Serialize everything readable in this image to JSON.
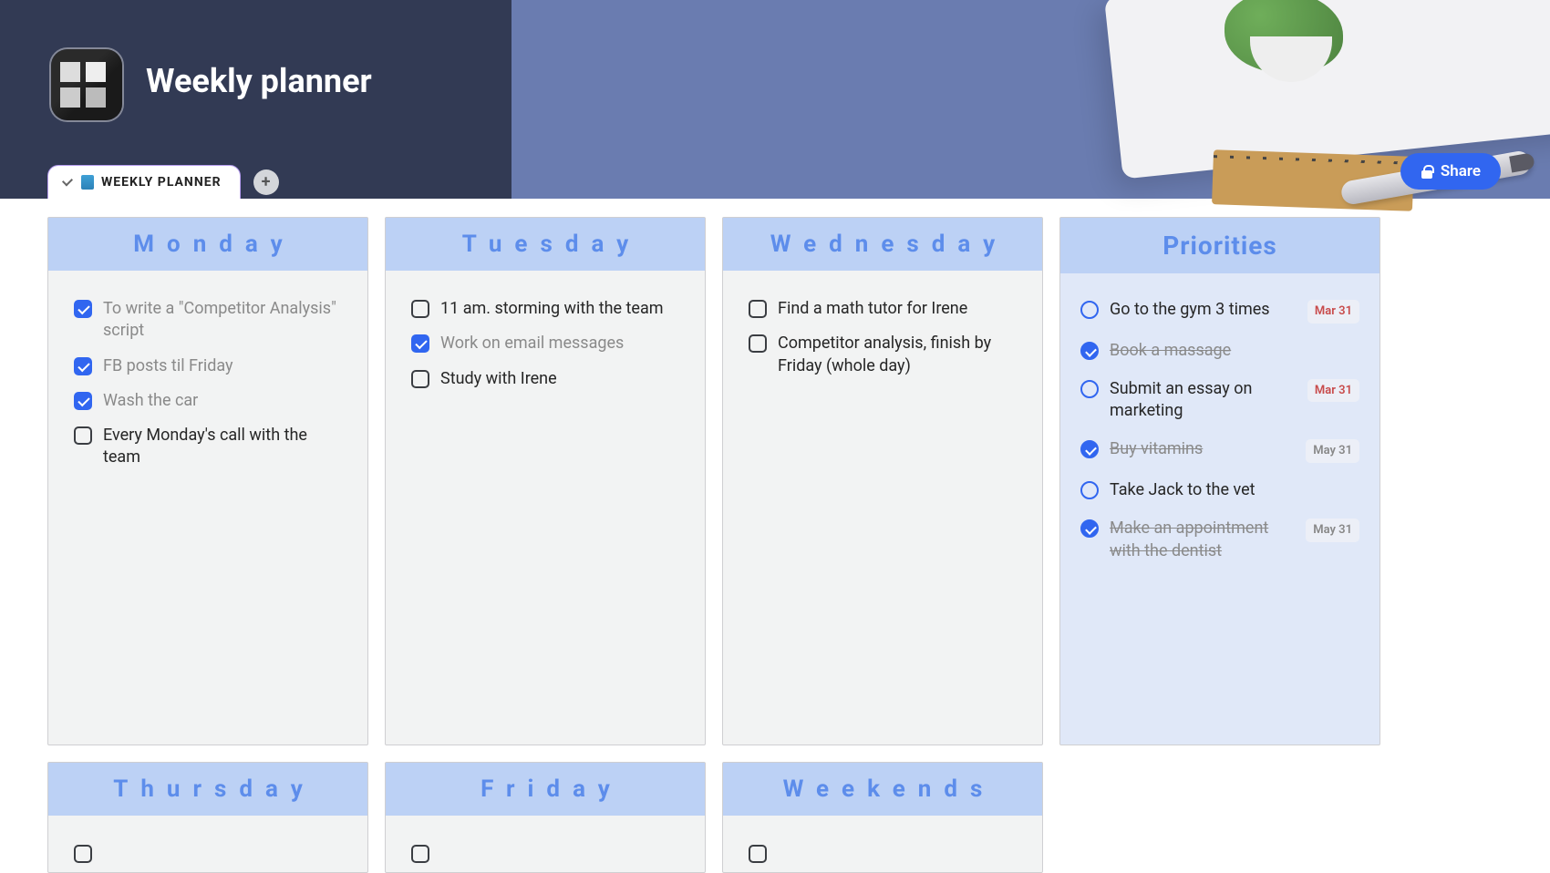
{
  "title": "Weekly planner",
  "tab_label": "WEEKLY PLANNER",
  "share_label": "Share",
  "days": {
    "monday": {
      "title": "Monday",
      "tasks": [
        {
          "text": "To write a \"Competitor Analysis\" script",
          "checked": true
        },
        {
          "text": "FB posts til Friday",
          "checked": true
        },
        {
          "text": "Wash the car",
          "checked": true
        },
        {
          "text": "Every Monday's call with the team",
          "checked": false
        }
      ]
    },
    "tuesday": {
      "title": "Tuesday",
      "tasks": [
        {
          "text": "11 am. storming with the team",
          "checked": false
        },
        {
          "text": "Work on email messages",
          "checked": true
        },
        {
          "text": "Study with Irene",
          "checked": false
        }
      ]
    },
    "wednesday": {
      "title": "Wednesday",
      "tasks": [
        {
          "text": "Find a math tutor for Irene",
          "checked": false
        },
        {
          "text": "Competitor analysis, finish by Friday (whole day)",
          "checked": false
        }
      ]
    },
    "thursday": {
      "title": "Thursday"
    },
    "friday": {
      "title": "Friday"
    },
    "weekends": {
      "title": "Weekends"
    }
  },
  "priorities": {
    "title": "Priorities",
    "items": [
      {
        "text": "Go to the gym 3 times",
        "checked": false,
        "date": "Mar 31",
        "date_red": true
      },
      {
        "text": "Book a massage",
        "checked": true
      },
      {
        "text": "Submit an essay on marketing",
        "checked": false,
        "date": "Mar 31",
        "date_red": true
      },
      {
        "text": "Buy vitamins",
        "checked": true,
        "date": "May 31"
      },
      {
        "text": "Take Jack to the vet",
        "checked": false
      },
      {
        "text": "Make an appointment with the dentist",
        "checked": true,
        "date": "May 31"
      }
    ]
  }
}
